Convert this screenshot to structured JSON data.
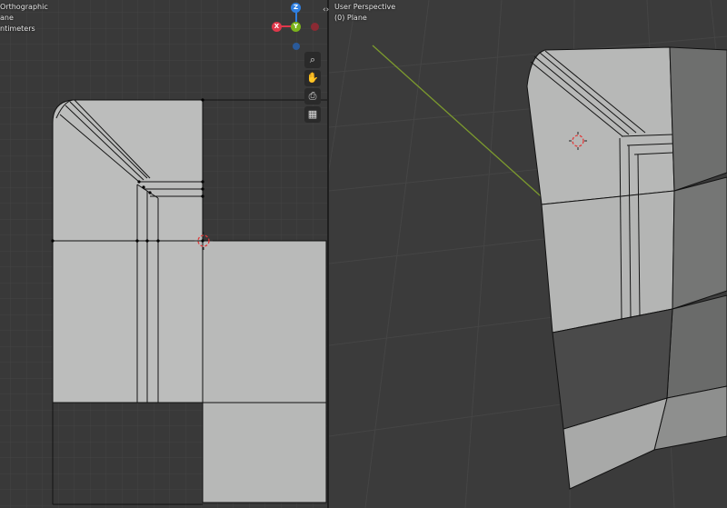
{
  "left_viewport": {
    "overlay_lines": [
      "Orthographic",
      "ane",
      "ntimeters"
    ],
    "gizmo": {
      "z_label": "Z",
      "x_label": "X",
      "y_label": "Y"
    },
    "nav_buttons": [
      {
        "icon": "zoom-icon",
        "glyph": "⌕"
      },
      {
        "icon": "hand-icon",
        "glyph": "✋"
      },
      {
        "icon": "camera-icon",
        "glyph": "⎙"
      },
      {
        "icon": "grid-icon",
        "glyph": "▦"
      }
    ]
  },
  "right_viewport": {
    "overlay_lines": [
      "User Perspective",
      "(0) Plane"
    ]
  },
  "split_arrows": "‹›",
  "colors": {
    "background": "#393939",
    "grid_minor": "#424242",
    "grid_major": "#4a4a4a",
    "mesh_face": "#bdbebd",
    "mesh_edge": "#141414",
    "axis_y": "#7c9a2e",
    "gizmo_x": "#e0384b",
    "gizmo_y": "#7bb31c",
    "gizmo_z": "#2f7fe0",
    "cursor": "#e03a3a"
  }
}
